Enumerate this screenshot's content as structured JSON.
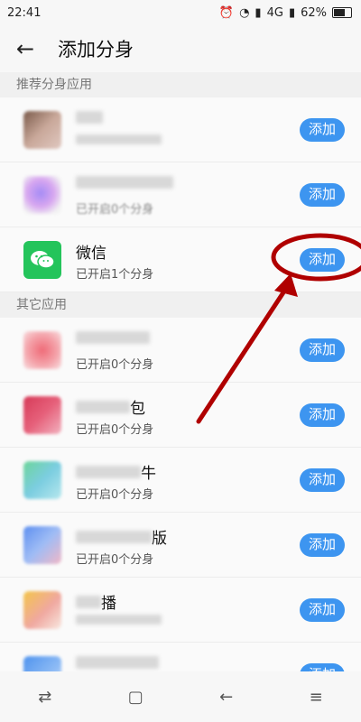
{
  "status": {
    "time": "22:41",
    "network": "4G",
    "battery": "62%"
  },
  "header": {
    "title": "添加分身"
  },
  "sections": {
    "recommended": "推荐分身应用",
    "others": "其它应用"
  },
  "apps": {
    "rec1": {
      "name": "",
      "sub": "",
      "button": "添加"
    },
    "rec2": {
      "name": "",
      "sub": "已开启0个分身",
      "button": "添加"
    },
    "wechat": {
      "name": "微信",
      "sub": "已开启1个分身",
      "button": "添加"
    },
    "oth1": {
      "name": "",
      "sub": "已开启0个分身",
      "button": "添加"
    },
    "oth2": {
      "name": "包",
      "sub": "已开启0个分身",
      "button": "添加"
    },
    "oth3": {
      "name": "牛",
      "sub": "已开启0个分身",
      "button": "添加"
    },
    "oth4": {
      "name": "版",
      "sub": "已开启0个分身",
      "button": "添加"
    },
    "oth5": {
      "name": "播",
      "sub": "",
      "button": "添加"
    },
    "oth6": {
      "name": "",
      "sub": "",
      "button": "添加"
    }
  },
  "colors": {
    "accent": "#3d95f0",
    "annotation": "#b00000",
    "wechat": "#24c45b"
  }
}
